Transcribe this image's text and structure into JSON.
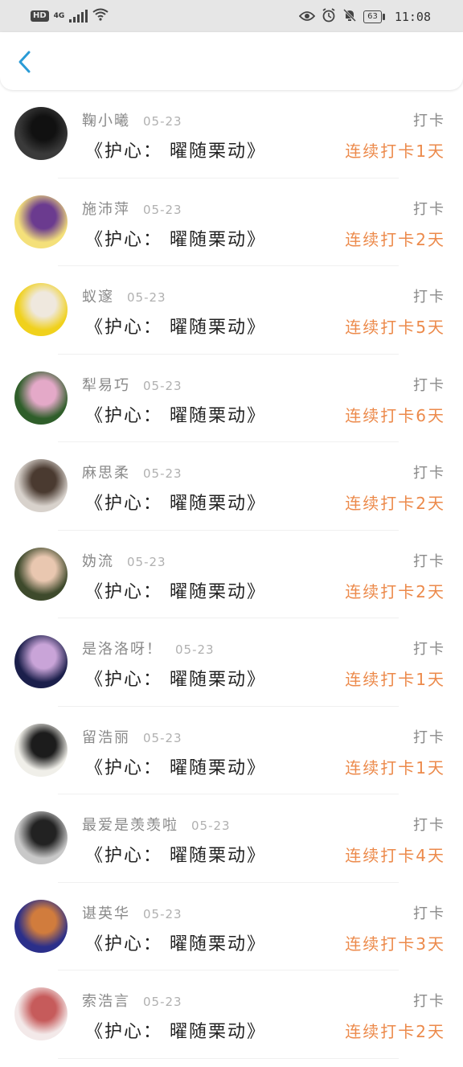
{
  "status_bar": {
    "left": "HD",
    "network": "4G",
    "battery": "63",
    "time": "11:08",
    "icons": [
      "eye-icon",
      "alarm-icon",
      "mute-bell-icon"
    ]
  },
  "header": {
    "back_icon": "chevron-left-icon",
    "accent": "#2a9bd6"
  },
  "streak_color": "#ec8a4b",
  "entries": [
    {
      "name": "鞠小曦",
      "date": "05-23",
      "status": "打卡",
      "book": "《护心： 曜随栗动》",
      "streak": "连续打卡1天",
      "avatar_colors": [
        "#3a3a3a",
        "#111111"
      ]
    },
    {
      "name": "施沛萍",
      "date": "05-23",
      "status": "打卡",
      "book": "《护心： 曜随栗动》",
      "streak": "连续打卡2天",
      "avatar_colors": [
        "#f4e07a",
        "#6b3b8f"
      ]
    },
    {
      "name": "蚁邃",
      "date": "05-23",
      "status": "打卡",
      "book": "《护心： 曜随栗动》",
      "streak": "连续打卡5天",
      "avatar_colors": [
        "#f0d11c",
        "#efe8de"
      ]
    },
    {
      "name": "犁易巧",
      "date": "05-23",
      "status": "打卡",
      "book": "《护心： 曜随栗动》",
      "streak": "连续打卡6天",
      "avatar_colors": [
        "#2f5e2a",
        "#e4a9c8"
      ]
    },
    {
      "name": "麻思柔",
      "date": "05-23",
      "status": "打卡",
      "book": "《护心： 曜随栗动》",
      "streak": "连续打卡2天",
      "avatar_colors": [
        "#d8d2cc",
        "#4a3a30"
      ]
    },
    {
      "name": "妫流",
      "date": "05-23",
      "status": "打卡",
      "book": "《护心： 曜随栗动》",
      "streak": "连续打卡2天",
      "avatar_colors": [
        "#3e4a2c",
        "#e9c7b0"
      ]
    },
    {
      "name": "是洛洛呀！",
      "date": "05-23",
      "status": "打卡",
      "book": "《护心： 曜随栗动》",
      "streak": "连续打卡1天",
      "avatar_colors": [
        "#1b1f4b",
        "#c9a4d8"
      ]
    },
    {
      "name": "留浩丽",
      "date": "05-23",
      "status": "打卡",
      "book": "《护心： 曜随栗动》",
      "streak": "连续打卡1天",
      "avatar_colors": [
        "#f0efe9",
        "#1c1c1c"
      ]
    },
    {
      "name": "最爱是羡羡啦",
      "date": "05-23",
      "status": "打卡",
      "book": "《护心： 曜随栗动》",
      "streak": "连续打卡4天",
      "avatar_colors": [
        "#c8c8c8",
        "#222222"
      ]
    },
    {
      "name": "谌英华",
      "date": "05-23",
      "status": "打卡",
      "book": "《护心： 曜随栗动》",
      "streak": "连续打卡3天",
      "avatar_colors": [
        "#2b2f8a",
        "#d17c3d"
      ]
    },
    {
      "name": "索浩言",
      "date": "05-23",
      "status": "打卡",
      "book": "《护心： 曜随栗动》",
      "streak": "连续打卡2天",
      "avatar_colors": [
        "#f3e9e9",
        "#c65b5b"
      ]
    }
  ]
}
